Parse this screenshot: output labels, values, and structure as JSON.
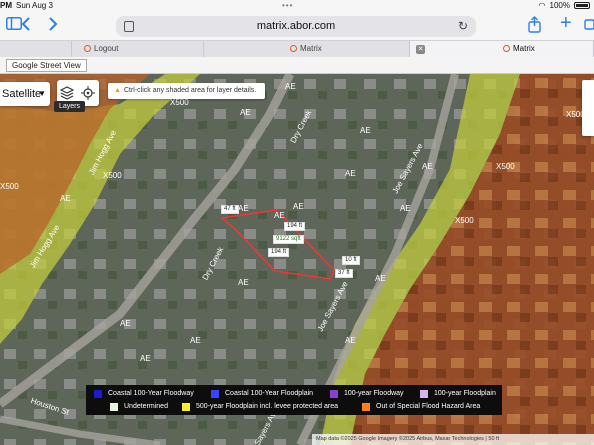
{
  "status": {
    "time": "PM",
    "date": "Sun Aug 3",
    "battery": "100%"
  },
  "toolbar": {
    "url": "matrix.abor.com",
    "icons": [
      "sidebar-icon",
      "back-icon",
      "forward-icon",
      "page-icon",
      "reload-icon",
      "share-icon",
      "new-tab-icon",
      "tabs-icon"
    ]
  },
  "tabs": [
    {
      "label": "Logout",
      "active": false
    },
    {
      "label": "Matrix",
      "active": false
    },
    {
      "label": "Matrix",
      "active": true
    }
  ],
  "map_bar": {
    "street_view_button": "Google Street View"
  },
  "map": {
    "type_label": "Satellite",
    "layers_tooltip": "Layers",
    "hint": "Ctrl-click any shaded area for layer details.",
    "street_labels": [
      "Jim Hogg Ave",
      "Jim Hogg Ave",
      "Houston St",
      "Joe Sayers Ave",
      "Joe Sayers Ave",
      "Joe Sayers Ave",
      "Dry Creek",
      "Dry Creek"
    ],
    "zone_labels": [
      "X500",
      "X500",
      "X500",
      "X500",
      "X500",
      "X500",
      "AE",
      "AE",
      "AE",
      "AE",
      "AE",
      "AE",
      "AE",
      "AE",
      "AE",
      "AE",
      "AE",
      "AE",
      "AE",
      "AE",
      "AE",
      "AE"
    ],
    "measurements": {
      "top": "47 ft",
      "right_top": "194 ft",
      "area": "9122 sqft",
      "bottom": "194 ft",
      "right_side": "10 ft",
      "right_bottom": "37 ft"
    },
    "attribution": "Map data ©2025 Google Imagery ©2025 Airbus, Maxar Technologies | 50 ft"
  },
  "legend": [
    {
      "label": "Coastal 100-Year Floodway",
      "color": "#1c1ccc"
    },
    {
      "label": "Coastal 100-Year Floodplain",
      "color": "#3a43ff"
    },
    {
      "label": "100-year Floodway",
      "color": "#8a3fd0"
    },
    {
      "label": "100-year Floodplain",
      "color": "#d7b4f0"
    },
    {
      "label": "Undetermined",
      "color": "#e8f4e0"
    },
    {
      "label": "500-year Floodplain incl. levee protected area",
      "color": "#f2ee2a"
    },
    {
      "label": "Out of Special Flood Hazard Area",
      "color": "#ff7f1a"
    }
  ]
}
